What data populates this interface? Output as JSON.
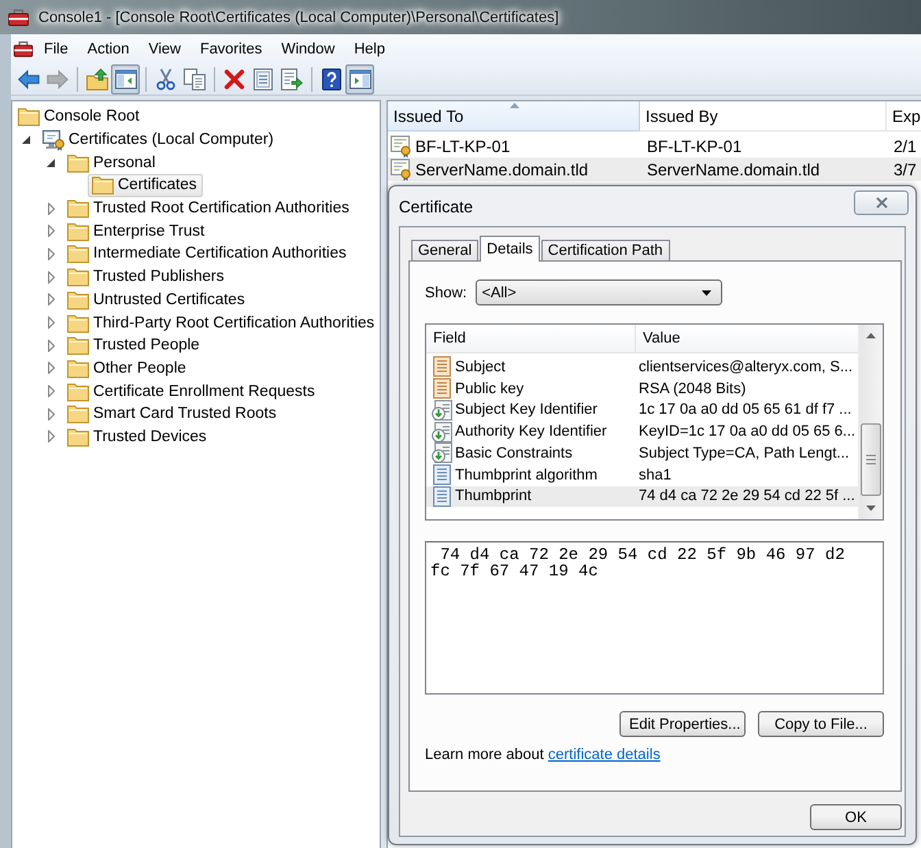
{
  "window": {
    "title": "Console1 - [Console Root\\Certificates (Local Computer)\\Personal\\Certificates]"
  },
  "menu": [
    "File",
    "Action",
    "View",
    "Favorites",
    "Window",
    "Help"
  ],
  "toolbar": [
    [
      {
        "kind": "back",
        "disabled": false,
        "pressed": false
      },
      {
        "kind": "forward",
        "disabled": true,
        "pressed": false
      }
    ],
    [
      {
        "kind": "up",
        "disabled": false,
        "pressed": false
      },
      {
        "kind": "tree_pane",
        "disabled": false,
        "pressed": true
      }
    ],
    [
      {
        "kind": "cut",
        "disabled": false,
        "pressed": false
      },
      {
        "kind": "copy",
        "disabled": false,
        "pressed": false
      }
    ],
    [
      {
        "kind": "delete",
        "disabled": false,
        "pressed": false
      },
      {
        "kind": "properties",
        "disabled": false,
        "pressed": false
      },
      {
        "kind": "export",
        "disabled": false,
        "pressed": false
      }
    ],
    [
      {
        "kind": "help",
        "disabled": false,
        "pressed": false
      },
      {
        "kind": "action_pane",
        "disabled": false,
        "pressed": true
      }
    ]
  ],
  "tree": [
    {
      "label": "Console Root",
      "kind": "folder",
      "expandable": false,
      "selected": false,
      "children": [
        {
          "label": "Certificates (Local Computer)",
          "kind": "store",
          "expandable": true,
          "expanded": true,
          "selected": false,
          "children": [
            {
              "label": "Personal",
              "kind": "folder",
              "expandable": true,
              "expanded": true,
              "selected": false,
              "children": [
                {
                  "label": "Certificates",
                  "kind": "folder",
                  "expandable": false,
                  "selected": true
                }
              ]
            },
            {
              "label": "Trusted Root Certification Authorities",
              "kind": "folder",
              "expandable": true,
              "expanded": false,
              "selected": false
            },
            {
              "label": "Enterprise Trust",
              "kind": "folder",
              "expandable": true,
              "expanded": false,
              "selected": false
            },
            {
              "label": "Intermediate Certification Authorities",
              "kind": "folder",
              "expandable": true,
              "expanded": false,
              "selected": false
            },
            {
              "label": "Trusted Publishers",
              "kind": "folder",
              "expandable": true,
              "expanded": false,
              "selected": false
            },
            {
              "label": "Untrusted Certificates",
              "kind": "folder",
              "expandable": true,
              "expanded": false,
              "selected": false
            },
            {
              "label": "Third-Party Root Certification Authorities",
              "kind": "folder",
              "expandable": true,
              "expanded": false,
              "selected": false
            },
            {
              "label": "Trusted People",
              "kind": "folder",
              "expandable": true,
              "expanded": false,
              "selected": false
            },
            {
              "label": "Other People",
              "kind": "folder",
              "expandable": true,
              "expanded": false,
              "selected": false
            },
            {
              "label": "Certificate Enrollment Requests",
              "kind": "folder",
              "expandable": true,
              "expanded": false,
              "selected": false
            },
            {
              "label": "Smart Card Trusted Roots",
              "kind": "folder",
              "expandable": true,
              "expanded": false,
              "selected": false
            },
            {
              "label": "Trusted Devices",
              "kind": "folder",
              "expandable": true,
              "expanded": false,
              "selected": false
            }
          ]
        }
      ]
    }
  ],
  "list": {
    "columns": [
      {
        "label": "Issued To",
        "sorted": true
      },
      {
        "label": "Issued By",
        "sorted": false
      },
      {
        "label": "Exp",
        "sorted": false
      }
    ],
    "rows": [
      {
        "cells": [
          "BF-LT-KP-01",
          "BF-LT-KP-01",
          "2/1"
        ],
        "selected": false
      },
      {
        "cells": [
          "ServerName.domain.tld",
          "ServerName.domain.tld",
          "3/7"
        ],
        "selected": true
      }
    ]
  },
  "dialog": {
    "title": "Certificate",
    "tabs": [
      {
        "label": "General",
        "selected": false
      },
      {
        "label": "Details",
        "selected": true
      },
      {
        "label": "Certification Path",
        "selected": false
      }
    ],
    "show": {
      "label": "Show:",
      "value": "<All>"
    },
    "fields": {
      "columns": [
        "Field",
        "Value"
      ],
      "rows": [
        {
          "kind": "attribute",
          "field": "Subject",
          "value": "clientservices@alteryx.com, S...",
          "selected": false
        },
        {
          "kind": "attribute",
          "field": "Public key",
          "value": "RSA (2048 Bits)",
          "selected": false
        },
        {
          "kind": "extension",
          "field": "Subject Key Identifier",
          "value": "1c 17 0a a0 dd 05 65 61 df f7 ...",
          "selected": false
        },
        {
          "kind": "extension",
          "field": "Authority Key Identifier",
          "value": "KeyID=1c 17 0a a0 dd 05 65 6...",
          "selected": false
        },
        {
          "kind": "extension",
          "field": "Basic Constraints",
          "value": "Subject Type=CA, Path Lengt...",
          "selected": false
        },
        {
          "kind": "property",
          "field": "Thumbprint algorithm",
          "value": "sha1",
          "selected": false
        },
        {
          "kind": "property",
          "field": "Thumbprint",
          "value": "74 d4 ca 72 2e 29 54 cd 22 5f ...",
          "selected": true
        }
      ]
    },
    "value_box": {
      "value": "74 d4 ca 72 2e 29 54 cd 22 5f 9b 46 97 d2 fc 7f 67 47 19 4c"
    },
    "buttons": [
      "Edit Properties...",
      "Copy to File..."
    ],
    "learn_more": {
      "text": "Learn more about",
      "link": "certificate details"
    },
    "ok_button": "OK"
  }
}
